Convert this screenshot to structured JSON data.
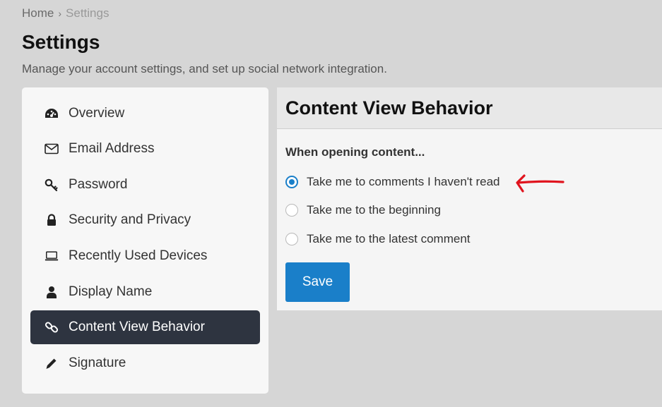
{
  "breadcrumb": {
    "home": "Home",
    "separator": "›",
    "current": "Settings"
  },
  "page": {
    "title": "Settings",
    "description": "Manage your account settings, and set up social network integration."
  },
  "sidebar": {
    "items": [
      {
        "label": "Overview",
        "icon": "gauge-icon"
      },
      {
        "label": "Email Address",
        "icon": "envelope-icon"
      },
      {
        "label": "Password",
        "icon": "key-icon"
      },
      {
        "label": "Security and Privacy",
        "icon": "lock-icon"
      },
      {
        "label": "Recently Used Devices",
        "icon": "laptop-icon"
      },
      {
        "label": "Display Name",
        "icon": "user-icon"
      },
      {
        "label": "Content View Behavior",
        "icon": "link-icon",
        "active": true
      },
      {
        "label": "Signature",
        "icon": "pencil-icon"
      }
    ],
    "active_color": "#2e3440"
  },
  "content": {
    "title": "Content View Behavior",
    "section_label": "When opening content...",
    "options": [
      {
        "label": "Take me to comments I haven't read",
        "checked": true
      },
      {
        "label": "Take me to the beginning",
        "checked": false
      },
      {
        "label": "Take me to the latest comment",
        "checked": false
      }
    ],
    "save_label": "Save",
    "accent_color": "#1a7fc9"
  },
  "annotation": {
    "icon": "red-arrow-icon",
    "color": "#e0141e"
  }
}
